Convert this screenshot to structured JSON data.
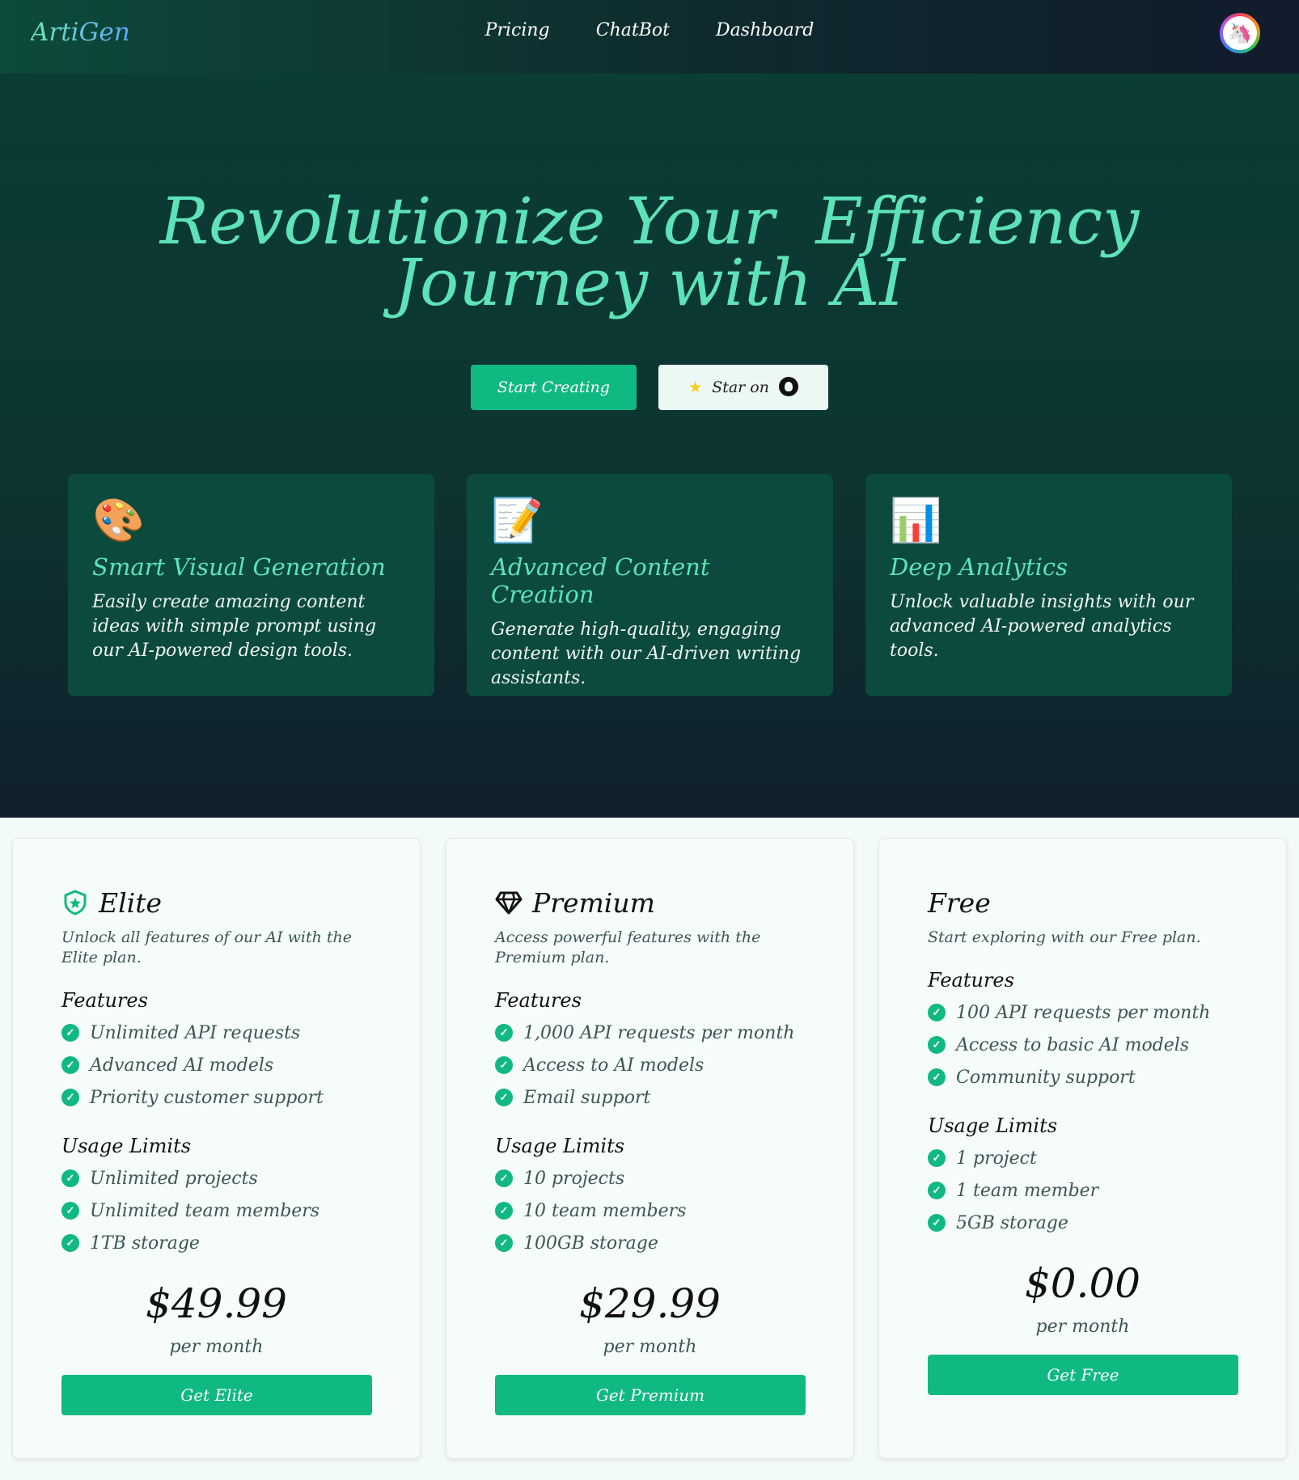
{
  "header": {
    "brand": "ArtiGen",
    "nav": [
      "Pricing",
      "ChatBot",
      "Dashboard"
    ],
    "avatar_icon": "unicorn-icon"
  },
  "hero": {
    "title_line1": "Revolutionize Your  Efficiency",
    "title_line2": "Journey with AI",
    "start_button": "Start Creating",
    "star_button": "Star on",
    "github_icon": "github-icon"
  },
  "features": [
    {
      "icon": "palette-icon",
      "title": "Smart Visual Generation",
      "text": "Easily create amazing content ideas with simple prompt using our AI-powered design tools."
    },
    {
      "icon": "memo-icon",
      "title": "Advanced Content Creation",
      "text": "Generate high-quality, engaging content with our AI-driven writing assistants."
    },
    {
      "icon": "bar-chart-icon",
      "title": "Deep Analytics",
      "text": "Unlock valuable insights with our advanced AI-powered analytics tools."
    }
  ],
  "plans": [
    {
      "name": "Elite",
      "icon": "shield-star-icon",
      "description": "Unlock all features of our AI with the Elite plan.",
      "features_title": "Features",
      "features": [
        "Unlimited API requests",
        "Advanced AI models",
        "Priority customer support"
      ],
      "limits_title": "Usage Limits",
      "limits": [
        "Unlimited projects",
        "Unlimited team members",
        "1TB storage"
      ],
      "price": "$49.99",
      "period": "per month",
      "button": "Get Elite"
    },
    {
      "name": "Premium",
      "icon": "diamond-icon",
      "description": "Access powerful features with the Premium plan.",
      "features_title": "Features",
      "features": [
        "1,000 API requests per month",
        "Access to AI models",
        "Email support"
      ],
      "limits_title": "Usage Limits",
      "limits": [
        "10 projects",
        "10 team members",
        "100GB storage"
      ],
      "price": "$29.99",
      "period": "per month",
      "button": "Get Premium"
    },
    {
      "name": "Free",
      "icon": "",
      "description": "Start exploring with our Free plan.",
      "features_title": "Features",
      "features": [
        "100 API requests per month",
        "Access to basic AI models",
        "Community support"
      ],
      "limits_title": "Usage Limits",
      "limits": [
        "1 project",
        "1 team member",
        "5GB storage"
      ],
      "price": "$0.00",
      "period": "per month",
      "button": "Get Free"
    }
  ],
  "colors": {
    "accent": "#10b981",
    "heading_green": "#5ee2b9",
    "hero_bg": "#0d3431"
  }
}
